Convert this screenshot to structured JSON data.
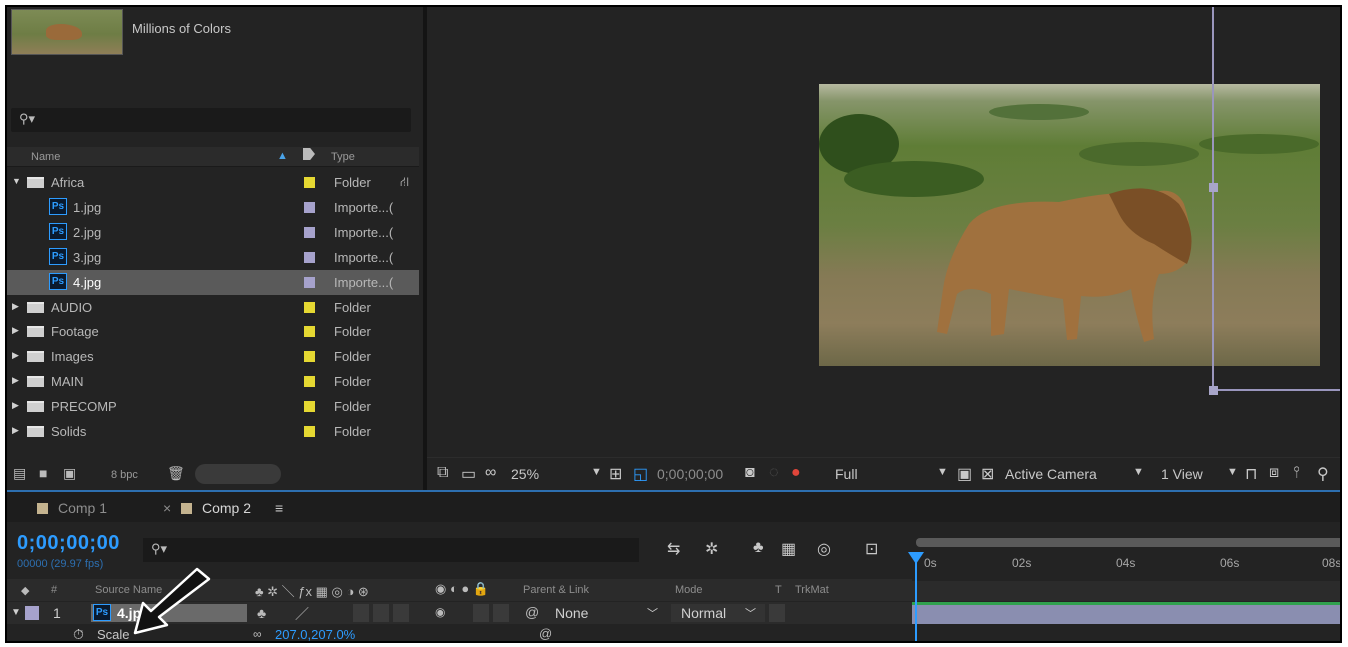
{
  "project": {
    "thumb_info": "Millions of Colors",
    "search_icon": "search-icon",
    "columns": {
      "name": "Name",
      "type": "Type"
    },
    "items": [
      {
        "name": "Africa",
        "type": "Folder",
        "kind": "folder",
        "open": true,
        "label_color": "#e5d832"
      },
      {
        "name": "1.jpg",
        "type": "Importe...(",
        "kind": "ps",
        "label_color": "#a6a2cc"
      },
      {
        "name": "2.jpg",
        "type": "Importe...(",
        "kind": "ps",
        "label_color": "#a6a2cc"
      },
      {
        "name": "3.jpg",
        "type": "Importe...(",
        "kind": "ps",
        "label_color": "#a6a2cc"
      },
      {
        "name": "4.jpg",
        "type": "Importe...(",
        "kind": "ps",
        "label_color": "#a6a2cc",
        "selected": true
      },
      {
        "name": "AUDIO",
        "type": "Folder",
        "kind": "folder",
        "label_color": "#e5d832"
      },
      {
        "name": "Footage",
        "type": "Folder",
        "kind": "folder",
        "label_color": "#e5d832"
      },
      {
        "name": "Images",
        "type": "Folder",
        "kind": "folder",
        "label_color": "#e5d832"
      },
      {
        "name": "MAIN",
        "type": "Folder",
        "kind": "folder",
        "label_color": "#e5d832"
      },
      {
        "name": "PRECOMP",
        "type": "Folder",
        "kind": "folder",
        "label_color": "#e5d832"
      },
      {
        "name": "Solids",
        "type": "Folder",
        "kind": "folder",
        "label_color": "#e5d832"
      }
    ],
    "bpc": "8 bpc"
  },
  "viewer": {
    "zoom": "25%",
    "timecode": "0;00;00;00",
    "resolution": "Full",
    "camera": "Active Camera",
    "views": "1 View"
  },
  "timeline": {
    "tabs": [
      {
        "label": "Comp 1",
        "active": false
      },
      {
        "label": "Comp 2",
        "active": true
      }
    ],
    "timecode": "0;00;00;00",
    "fps": "00000 (29.97 fps)",
    "columns": {
      "num": "#",
      "source": "Source Name",
      "parent": "Parent & Link",
      "mode": "Mode",
      "t": "T",
      "trkmat": "TrkMat"
    },
    "layer": {
      "index": "1",
      "name": "4.jpg",
      "parent": "None",
      "mode": "Normal"
    },
    "property": {
      "name": "Scale",
      "value": "207.0,207.0%"
    },
    "ruler_labels": [
      "0s",
      "02s",
      "04s",
      "06s",
      "08s"
    ]
  },
  "colors": {
    "accent": "#2d9cff",
    "folder_label": "#e5d832",
    "file_label": "#a6a2cc"
  }
}
